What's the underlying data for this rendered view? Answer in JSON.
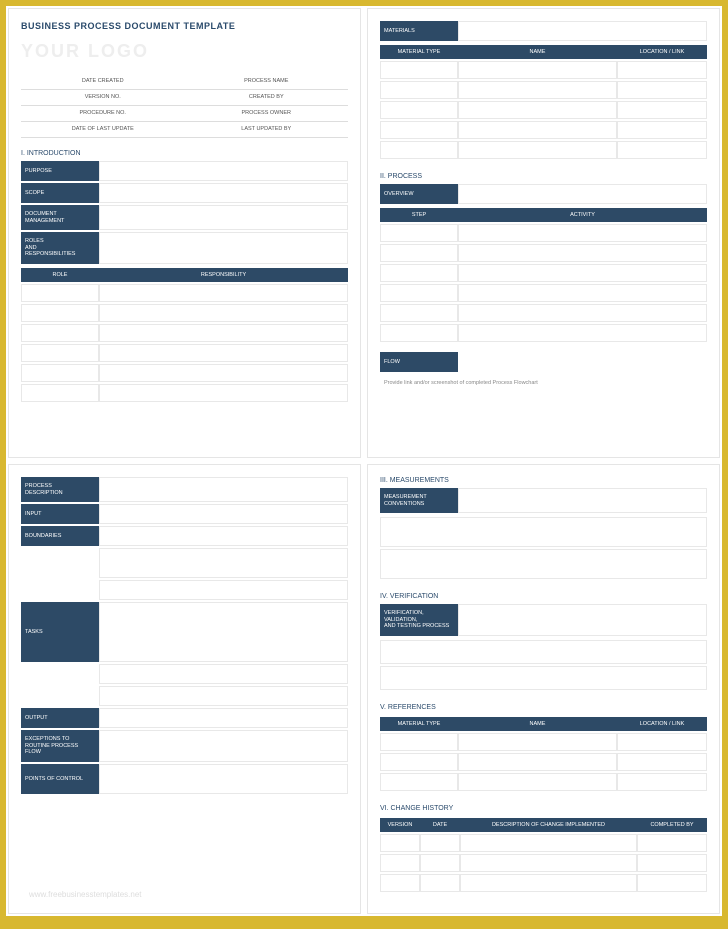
{
  "title": "BUSINESS PROCESS DOCUMENT TEMPLATE",
  "logo": "YOUR LOGO",
  "meta": [
    {
      "l": "DATE CREATED",
      "r": "PROCESS NAME"
    },
    {
      "l": "VERSION NO.",
      "r": "CREATED BY"
    },
    {
      "l": "PROCEDURE NO.",
      "r": "PROCESS OWNER"
    },
    {
      "l": "DATE OF LAST UPDATE",
      "r": "LAST UPDATED BY"
    }
  ],
  "s1": {
    "h": "I.   INTRODUCTION",
    "purpose": "PURPOSE",
    "scope": "SCOPE",
    "dm": "DOCUMENT MANAGEMENT",
    "rr": "ROLES\nAND\nRESPONSIBILITIES",
    "role": "ROLE",
    "resp": "RESPONSIBILITY"
  },
  "s_mat": {
    "h": "MATERIALS",
    "c1": "MATERIAL TYPE",
    "c2": "NAME",
    "c3": "LOCATION / LINK"
  },
  "s2": {
    "h": "II.  PROCESS",
    "ov": "OVERVIEW",
    "step": "STEP",
    "act": "ACTIVITY",
    "flow": "FLOW",
    "note": "Provide link and/or screenshot of completed Process Flowchart"
  },
  "p2": {
    "pd": "PROCESS\nDESCRIPTION",
    "input": "INPUT",
    "bound": "BOUNDARIES",
    "tasks": "TASKS",
    "output": "OUTPUT",
    "exc": "EXCEPTIONS TO\nROUTINE PROCESS FLOW",
    "poc": "POINTS OF CONTROL"
  },
  "footer": "www.freebusinesstemplates.net",
  "s3": {
    "h": "III. MEASUREMENTS",
    "mc": "MEASUREMENT\nCONVENTIONS"
  },
  "s4": {
    "h": "IV.  VERIFICATION",
    "v": "VERIFICATION, VALIDATION,\nAND TESTING PROCESS"
  },
  "s5": {
    "h": "V.   REFERENCES",
    "c1": "MATERIAL TYPE",
    "c2": "NAME",
    "c3": "LOCATION / LINK"
  },
  "s6": {
    "h": "VI. CHANGE HISTORY",
    "c1": "VERSION",
    "c2": "DATE",
    "c3": "DESCRIPTION OF CHANGE IMPLEMENTED",
    "c4": "COMPLETED BY"
  }
}
